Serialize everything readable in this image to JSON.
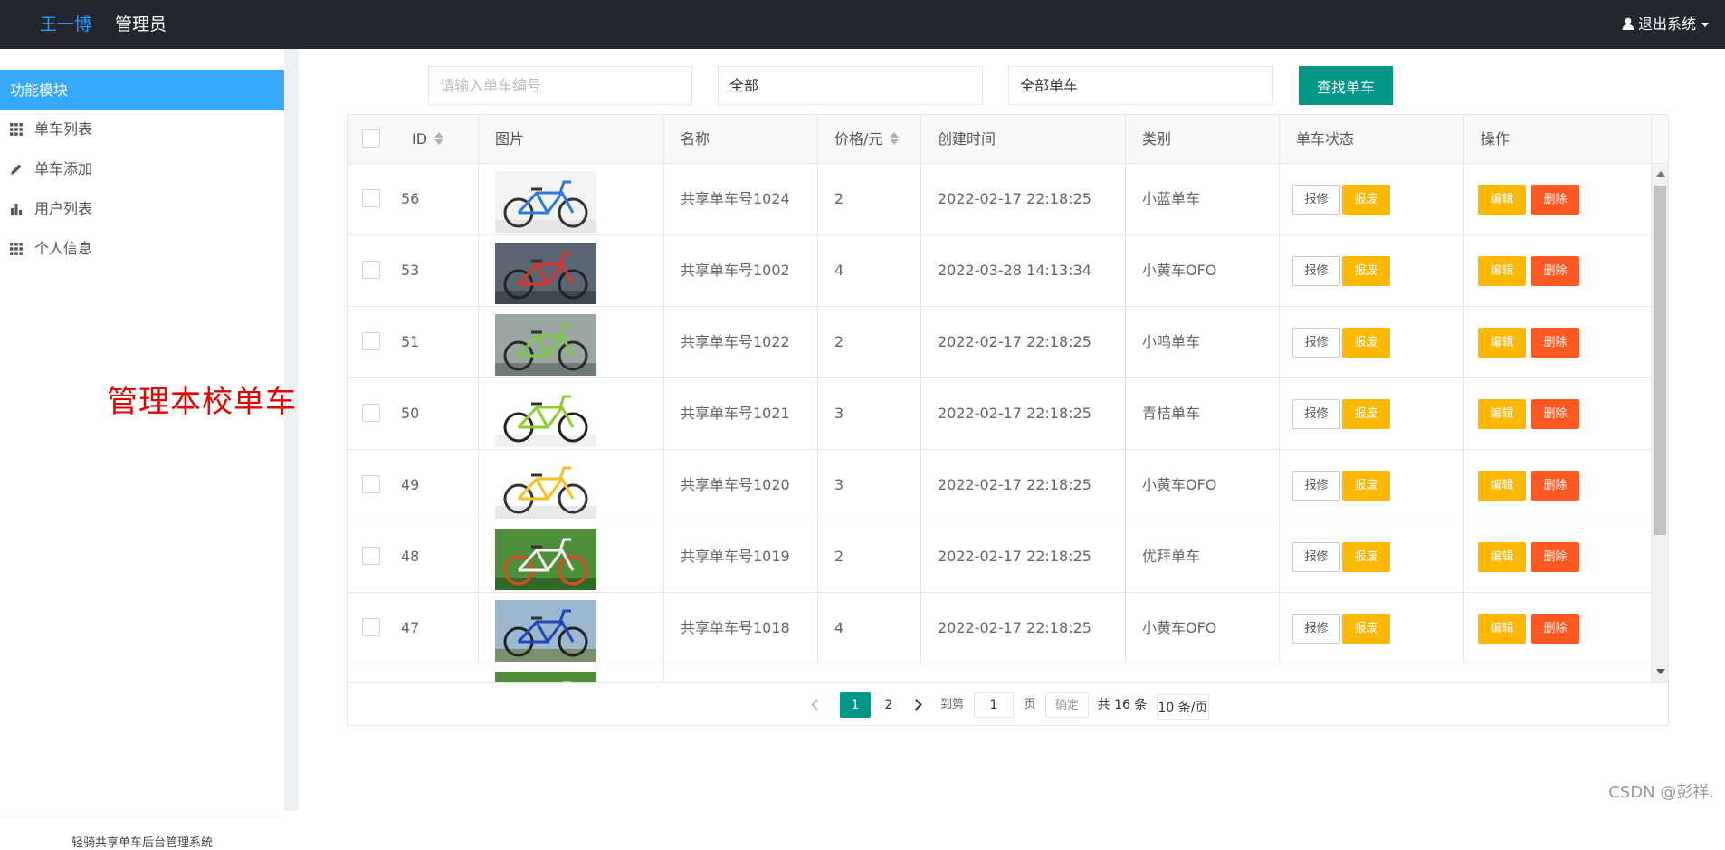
{
  "header": {
    "brand": "王一博",
    "role": "管理员",
    "logout_label": "退出系统"
  },
  "sidebar": {
    "section_title": "功能模块",
    "items": [
      {
        "label": "单车列表",
        "icon": "grid-icon"
      },
      {
        "label": "单车添加",
        "icon": "pencil-icon"
      },
      {
        "label": "用户列表",
        "icon": "bar-chart-icon"
      },
      {
        "label": "个人信息",
        "icon": "grid-icon"
      }
    ],
    "annotation": "管理本校单车",
    "footer": "轻骑共享单车后台管理系统"
  },
  "search": {
    "id_placeholder": "请输入单车编号",
    "filter1_value": "全部",
    "filter2_value": "全部单车",
    "button_label": "查找单车"
  },
  "table": {
    "columns": {
      "id": "ID",
      "image": "图片",
      "name": "名称",
      "price": "价格/元",
      "created": "创建时间",
      "category": "类别",
      "status": "单车状态",
      "actions": "操作"
    },
    "buttons": {
      "repair": "报修",
      "scrap": "报废",
      "edit": "编辑",
      "delete": "删除"
    },
    "rows": [
      {
        "id": "56",
        "name": "共享单车号1024",
        "price": "2",
        "created": "2022-02-17 22:18:25",
        "category": "小蓝单车",
        "thumb": "blue-white"
      },
      {
        "id": "53",
        "name": "共享单车号1002",
        "price": "4",
        "created": "2022-03-28 14:13:34",
        "category": "小黄车OFO",
        "thumb": "red"
      },
      {
        "id": "51",
        "name": "共享单车号1022",
        "price": "2",
        "created": "2022-02-17 22:18:25",
        "category": "小鸣单车",
        "thumb": "green-street"
      },
      {
        "id": "50",
        "name": "共享单车号1021",
        "price": "3",
        "created": "2022-02-17 22:18:25",
        "category": "青桔单车",
        "thumb": "lime"
      },
      {
        "id": "49",
        "name": "共享单车号1020",
        "price": "3",
        "created": "2022-02-17 22:18:25",
        "category": "小黄车OFO",
        "thumb": "yellow"
      },
      {
        "id": "48",
        "name": "共享单车号1019",
        "price": "2",
        "created": "2022-02-17 22:18:25",
        "category": "优拜单车",
        "thumb": "green-park"
      },
      {
        "id": "47",
        "name": "共享单车号1018",
        "price": "4",
        "created": "2022-02-17 22:18:25",
        "category": "小黄车OFO",
        "thumb": "blue-street"
      }
    ]
  },
  "pager": {
    "pages": [
      "1",
      "2"
    ],
    "current": "1",
    "goto_label": "到第",
    "goto_value": "1",
    "page_unit": "页",
    "confirm_label": "确定",
    "total_label": "共 16 条",
    "page_size_label": "10 条/页"
  },
  "watermark": "CSDN @彭祥.",
  "colors": {
    "header_bg": "#23262e",
    "accent_blue": "#36a9ff",
    "brand_blue": "#1e9fff",
    "teal": "#009688",
    "warn": "#ffb800",
    "danger": "#ff5722"
  }
}
